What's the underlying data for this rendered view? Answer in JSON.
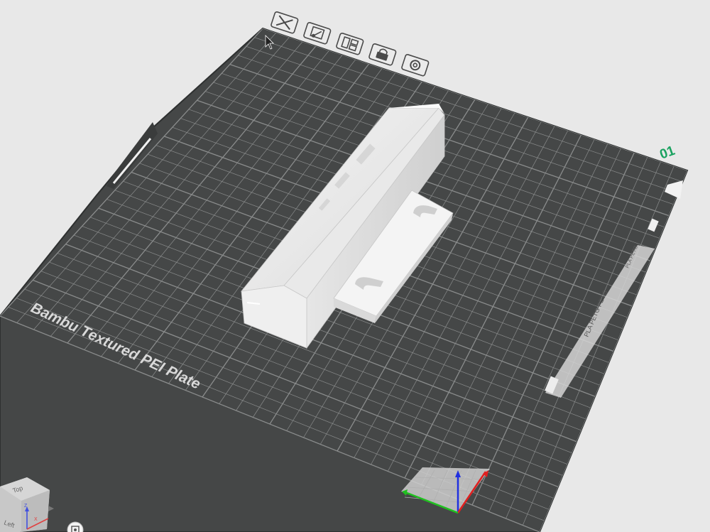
{
  "plate": {
    "label": "Bambu Textured PEI Plate",
    "number": "01",
    "side_label": "PLA PETG PETG",
    "side_label_small": "PLA PETG"
  },
  "toolbar": {
    "buttons": [
      {
        "name": "delete-plate-button",
        "icon": "close-icon"
      },
      {
        "name": "auto-orient-button",
        "icon": "orient-icon"
      },
      {
        "name": "arrange-button",
        "icon": "arrange-icon"
      },
      {
        "name": "lock-plate-button",
        "icon": "lock-icon"
      },
      {
        "name": "plate-settings-button",
        "icon": "gear-icon"
      }
    ]
  },
  "view_cube": {
    "top_label": "Top",
    "left_label": "Left",
    "axis_z": "Z",
    "axis_x": "X"
  },
  "colors": {
    "background": "#e8e8e8",
    "plate": "#454747",
    "grid": "#8a8c8c",
    "plate_number": "#1aa260",
    "axis_x": "#e02020",
    "axis_y": "#20c020",
    "axis_z": "#2030e0"
  }
}
